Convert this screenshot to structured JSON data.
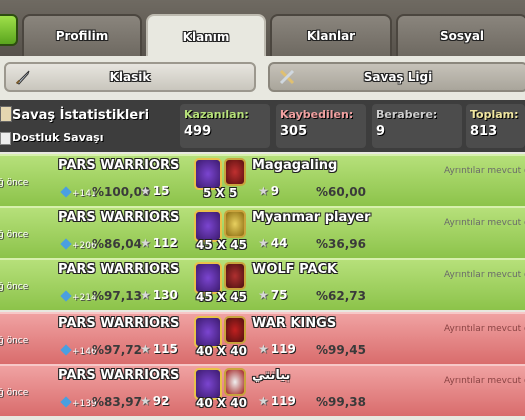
{
  "tabs": [
    {
      "label": "Profilim",
      "active": false
    },
    {
      "label": "Klanım",
      "active": true
    },
    {
      "label": "Klanlar",
      "active": false
    },
    {
      "label": "Sosyal",
      "active": false
    }
  ],
  "subtabs": {
    "classic": {
      "label": "Klasik",
      "icon": "sword-icon"
    },
    "league": {
      "label": "Savaş Ligi",
      "icon": "crossed-swords-icon"
    }
  },
  "stats": {
    "title": "Savaş İstatistikleri",
    "friendly_label": "Dostluk Savaşı",
    "won": {
      "label": "Kazanılan:",
      "value": "499",
      "color": "#b6e07a"
    },
    "lost": {
      "label": "Kaybedilen:",
      "value": "305",
      "color": "#f0a0a0"
    },
    "draw": {
      "label": "Berabere:",
      "value": "9",
      "color": "#cfcfcf"
    },
    "total": {
      "label": "Toplam:",
      "value": "813",
      "color": "#f0e6a0"
    }
  },
  "wars": [
    {
      "result": "win",
      "ago": "ğ önce",
      "clan": "PARS WARRIORS",
      "xp": "+141",
      "pct": "%100,00",
      "stars": "15",
      "size": "5 X 5",
      "opponent": "Magagaling",
      "opp_stars": "9",
      "opp_pct": "%60,00",
      "details": "Ayrıntılar mevcut d"
    },
    {
      "result": "win",
      "ago": "ğ önce",
      "clan": "PARS WARRIORS",
      "xp": "+206",
      "pct": "%86,04",
      "stars": "112",
      "size": "45 X 45",
      "opponent": "Myanmar player",
      "opp_stars": "44",
      "opp_pct": "%36,96",
      "details": "Ayrıntılar mevcut d"
    },
    {
      "result": "win",
      "ago": "ğ önce",
      "clan": "PARS WARRIORS",
      "xp": "+214",
      "pct": "%97,13",
      "stars": "130",
      "size": "45 X 45",
      "opponent": "WOLF PACK",
      "opp_stars": "75",
      "opp_pct": "%62,73",
      "details": "Ayrıntılar mevcut d"
    },
    {
      "result": "lose",
      "ago": "ğ önce",
      "clan": "PARS WARRIORS",
      "xp": "+146",
      "pct": "%97,72",
      "stars": "115",
      "size": "40 X 40",
      "opponent": "WAR KINGS",
      "opp_stars": "119",
      "opp_pct": "%99,45",
      "details": "Ayrıntılar mevcut d"
    },
    {
      "result": "lose",
      "ago": "ğ önce",
      "clan": "PARS WARRIORS",
      "xp": "+139",
      "pct": "%83,97",
      "stars": "92",
      "size": "40 X 40",
      "opponent": "بيانتي",
      "opp_stars": "119",
      "opp_pct": "%99,38",
      "details": "Ayrıntılar mevcut d"
    }
  ]
}
